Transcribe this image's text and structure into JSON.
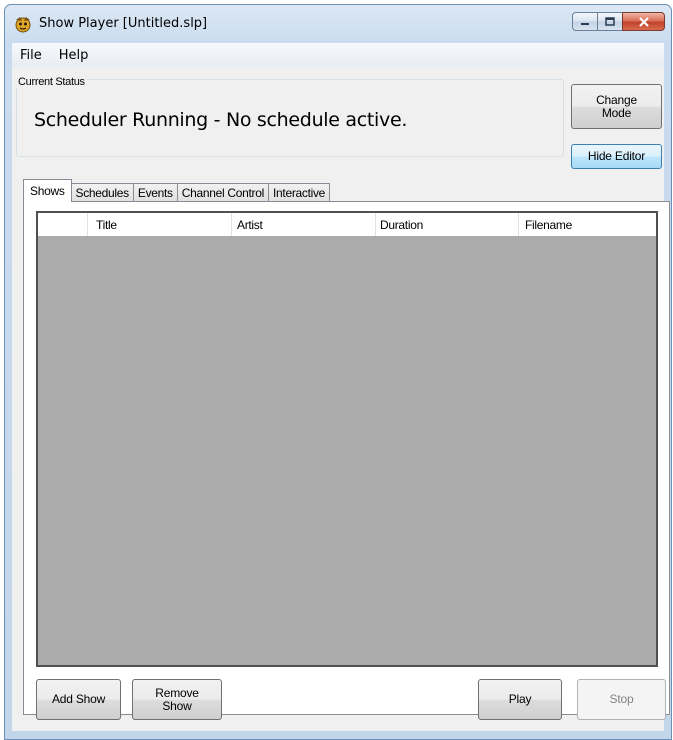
{
  "window": {
    "title": "Show Player [Untitled.slp]",
    "icons": {
      "app": "show-player-icon",
      "minimize": "minimize-icon",
      "maximize": "maximize-icon",
      "close": "close-icon"
    }
  },
  "menu": {
    "items": [
      "File",
      "Help"
    ]
  },
  "status": {
    "group_label": "Current Status",
    "text": "Scheduler Running - No schedule active."
  },
  "side_buttons": {
    "change_mode": "Change\nMode",
    "hide_editor": "Hide Editor"
  },
  "tabs": [
    "Shows",
    "Schedules",
    "Events",
    "Channel Control",
    "Interactive"
  ],
  "active_tab": "Shows",
  "grid": {
    "columns": [
      "Title",
      "Artist",
      "Duration",
      "Filename"
    ],
    "rows": []
  },
  "bottom_buttons": {
    "add_show": "Add Show",
    "remove_show": "Remove\nShow",
    "play": "Play",
    "stop": "Stop"
  },
  "colors": {
    "grid_background": "#ababab",
    "focused_button": "#bee6fd",
    "close_button": "#c2432b"
  }
}
